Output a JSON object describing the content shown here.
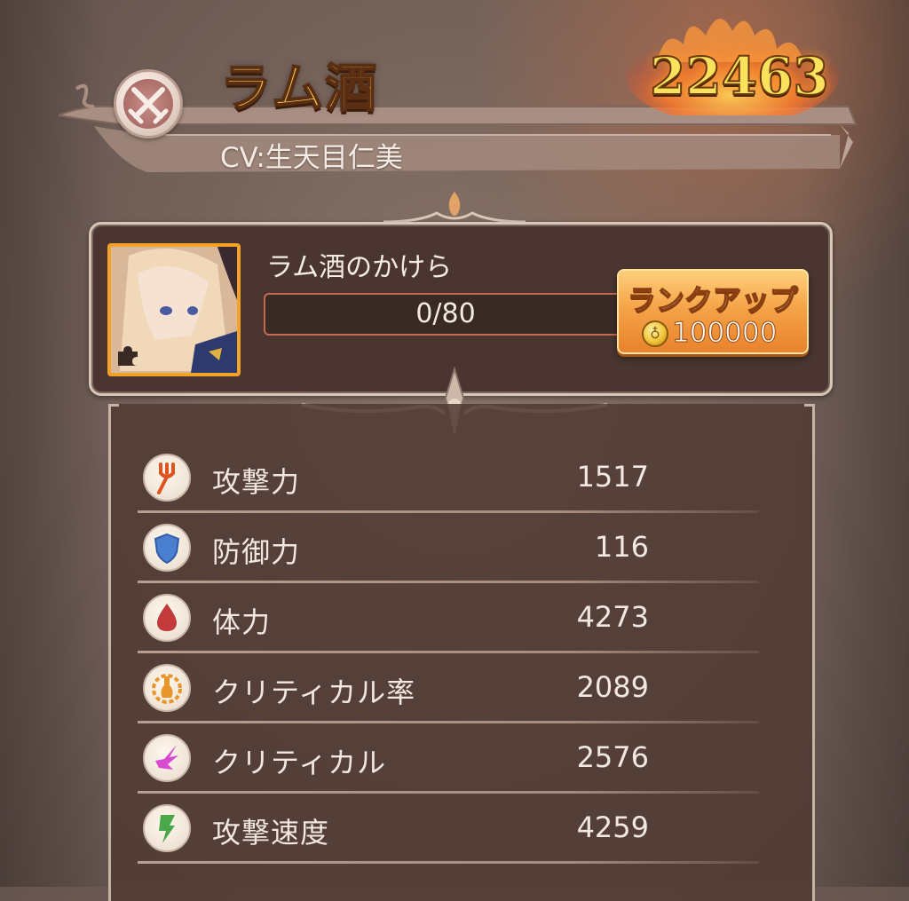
{
  "header": {
    "name": "ラム酒",
    "power": "22463",
    "cv": "CV:生天目仁美",
    "class_icon": "crossed-swords-icon"
  },
  "rank_panel": {
    "shard_name": "ラム酒のかけら",
    "progress_text": "0/80",
    "progress_fraction": 0,
    "rankup_label": "ランクアップ",
    "rankup_cost": "100000",
    "currency_icon": "gold-coin-icon",
    "colors": {
      "frame": "#f2a326",
      "button": "#f5a449"
    }
  },
  "stats": [
    {
      "label": "攻撃力",
      "value": "1517",
      "icon": "fork-icon"
    },
    {
      "label": "防御力",
      "value": "116",
      "icon": "shield-icon"
    },
    {
      "label": "体力",
      "value": "4273",
      "icon": "blood-drop-icon"
    },
    {
      "label": "クリティカル率",
      "value": "2089",
      "icon": "gear-flask-icon"
    },
    {
      "label": "クリティカル",
      "value": "2576",
      "icon": "burst-icon"
    },
    {
      "label": "攻撃速度",
      "value": "4259",
      "icon": "lightning-icon"
    }
  ]
}
